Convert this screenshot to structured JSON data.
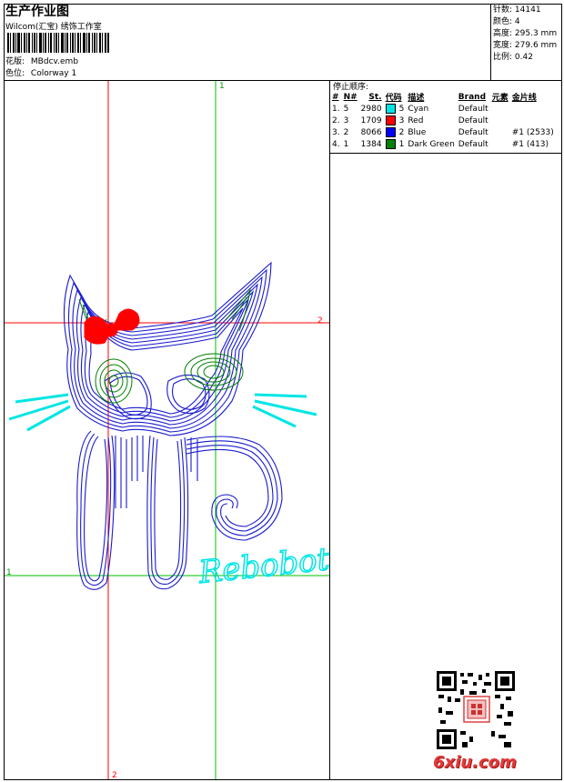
{
  "header": {
    "title": "生产作业图",
    "company": "Wilcom(汇宝) 绣饰工作室",
    "design_label": "花版:",
    "design_value": "MBdcv.emb",
    "color_label": "色位:",
    "color_value": "Colorway 1"
  },
  "stats": {
    "stitches_label": "针数:",
    "stitches_value": "14141",
    "colors_label": "颜色:",
    "colors_value": "4",
    "height_label": "高度:",
    "height_value": "295.3 mm",
    "width_label": "宽度:",
    "width_value": "279.6 mm",
    "scale_label": "比例:",
    "scale_value": "0.42"
  },
  "stop_sequence": {
    "title": "停止顺序:",
    "columns": [
      "#",
      "N#",
      "St.",
      "代码",
      "描述",
      "Brand",
      "元素",
      "金片线"
    ],
    "rows": [
      {
        "num": "1.",
        "n": "5",
        "st": "2980",
        "color": "#00e5e5",
        "code": "5",
        "desc": "Cyan",
        "brand": "Default",
        "elem": "",
        "seq": ""
      },
      {
        "num": "2.",
        "n": "3",
        "st": "1709",
        "color": "#ff0000",
        "code": "3",
        "desc": "Red",
        "brand": "Default",
        "elem": "",
        "seq": ""
      },
      {
        "num": "3.",
        "n": "2",
        "st": "8066",
        "color": "#0000ff",
        "code": "2",
        "desc": "Blue",
        "brand": "Default",
        "elem": "",
        "seq": "#1 (2533)"
      },
      {
        "num": "4.",
        "n": "1",
        "st": "1384",
        "color": "#008000",
        "code": "1",
        "desc": "Dark Green",
        "brand": "Default",
        "elem": "",
        "seq": "#1 (413)"
      }
    ]
  },
  "guides": {
    "v_green": "1",
    "h_red": "2",
    "h_green": "1",
    "v_red": "2"
  },
  "design_text": "Rebobotb",
  "watermark": "6xiu.com",
  "colors": {
    "cyan": "#00e5e5",
    "red": "#ff0000",
    "blue": "#0000ff",
    "green": "#008000",
    "guide_red": "#ff0000",
    "guide_green": "#00c000"
  }
}
